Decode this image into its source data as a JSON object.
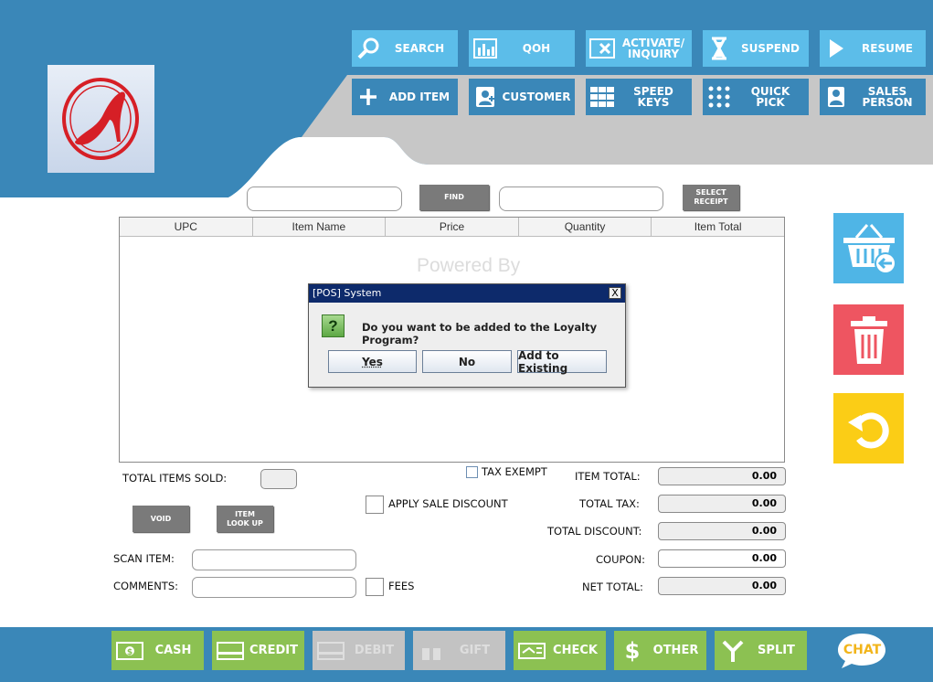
{
  "toolbar_top": [
    {
      "label": "SEARCH",
      "icon": "magnifier-icon"
    },
    {
      "label": "QOH",
      "icon": "bar-chart-icon"
    },
    {
      "label": "ACTIVATE/\nINQUIRY",
      "icon": "card-x-icon"
    },
    {
      "label": "SUSPEND",
      "icon": "hourglass-icon"
    },
    {
      "label": "RESUME",
      "icon": "play-icon"
    }
  ],
  "toolbar_bottom": [
    {
      "label": "ADD ITEM",
      "icon": "plus-icon"
    },
    {
      "label": "CUSTOMER",
      "icon": "customer-icon"
    },
    {
      "label": "SPEED KEYS",
      "icon": "keypad-icon"
    },
    {
      "label": "QUICK PICK",
      "icon": "dots-grid-icon"
    },
    {
      "label": "SALES\nPERSON",
      "icon": "person-icon"
    }
  ],
  "search": {
    "find_label": "FIND",
    "select_receipt_label": "SELECT\nRECEIPT"
  },
  "grid": {
    "columns": [
      "UPC",
      "Item Name",
      "Price",
      "Quantity",
      "Item Total"
    ],
    "watermark": "Powered By"
  },
  "dialog": {
    "title": "[POS] System",
    "close": "X",
    "question_icon": "?",
    "message": "Do you want to be added to the Loyalty Program?",
    "buttons": [
      "Yes",
      "No",
      "Add to Existing"
    ]
  },
  "left_panel": {
    "total_items_sold_label": "TOTAL ITEMS SOLD:",
    "void_label": "VOID",
    "item_lookup_label": "ITEM\nLOOK UP",
    "scan_item_label": "SCAN ITEM:",
    "comments_label": "COMMENTS:",
    "apply_sale_discount_label": "APPLY SALE DISCOUNT",
    "fees_label": "FEES",
    "tax_exempt_label": "TAX EXEMPT"
  },
  "totals": [
    {
      "label": "ITEM TOTAL:",
      "value": "0.00"
    },
    {
      "label": "TOTAL TAX:",
      "value": "0.00"
    },
    {
      "label": "TOTAL DISCOUNT:",
      "value": "0.00"
    },
    {
      "label": "COUPON:",
      "value": "0.00"
    },
    {
      "label": "NET TOTAL:",
      "value": "0.00"
    }
  ],
  "side_buttons": [
    {
      "icon": "basket-return-icon",
      "color": "#4fb5e6"
    },
    {
      "icon": "trash-icon",
      "color": "#ee5561"
    },
    {
      "icon": "undo-icon",
      "color": "#fbcd16"
    }
  ],
  "payments": [
    {
      "label": "CASH",
      "icon": "cash-icon",
      "enabled": true
    },
    {
      "label": "CREDIT",
      "icon": "credit-card-icon",
      "enabled": true
    },
    {
      "label": "DEBIT",
      "icon": "debit-card-icon",
      "enabled": false
    },
    {
      "label": "GIFT",
      "icon": "gift-icon",
      "enabled": false
    },
    {
      "label": "CHECK",
      "icon": "check-icon",
      "enabled": true
    },
    {
      "label": "OTHER",
      "icon": "dollar-icon",
      "enabled": true
    },
    {
      "label": "SPLIT",
      "icon": "split-icon",
      "enabled": true
    }
  ],
  "chat_label": "CHAT",
  "colors": {
    "header_blue": "#3a87b8",
    "header_light": "#5cbde9",
    "gray_band": "#c7c7c7",
    "pay_green": "#8cc152",
    "title_blue": "#0d2a6b"
  }
}
